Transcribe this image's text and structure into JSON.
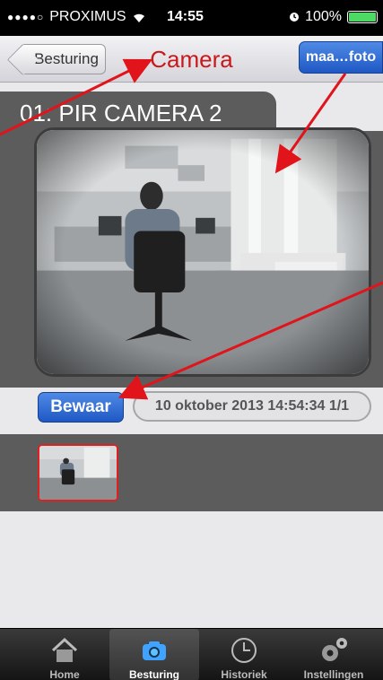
{
  "status_bar": {
    "carrier": "PROXIMUS",
    "time": "14:55",
    "battery": "100%",
    "battery_level": 1.0
  },
  "nav": {
    "back_label": "Besturing",
    "title": "Camera",
    "photo_button": "maa…foto"
  },
  "camera": {
    "name": "01: PIR CAMERA 2"
  },
  "save_row": {
    "save_label": "Bewaar",
    "timestamp": "10 oktober 2013 14:54:34 1/1"
  },
  "tabs": [
    {
      "label": "Home",
      "icon": "home-icon",
      "active": false
    },
    {
      "label": "Besturing",
      "icon": "camera-icon",
      "active": true
    },
    {
      "label": "Historiek",
      "icon": "clock-icon",
      "active": false
    },
    {
      "label": "Instellingen",
      "icon": "gears-icon",
      "active": false
    }
  ],
  "colors": {
    "title_red": "#c8191c",
    "button_blue": "#2a63d0",
    "panel_gray": "#5c5c5c",
    "arrow_red": "#e0141a"
  }
}
